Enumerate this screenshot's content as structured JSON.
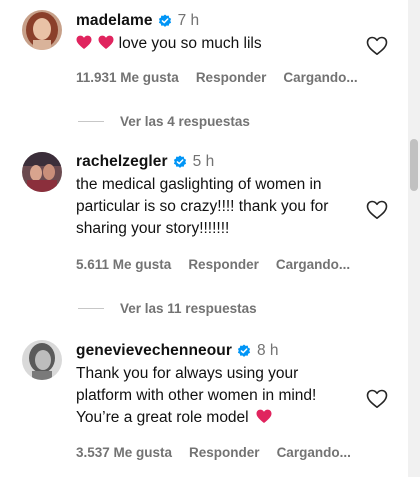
{
  "comments": [
    {
      "username": "madelame",
      "time": "7 h",
      "text": "love you so much lils",
      "likes": "11.931 Me gusta",
      "reply": "Responder",
      "loading": "Cargando...",
      "view_replies": "Ver las 4 respuestas"
    },
    {
      "username": "rachelzegler",
      "time": "5 h",
      "text": "the medical gaslighting of women in particular is so crazy!!!! thank you for sharing your story!!!!!!!",
      "likes": "5.611 Me gusta",
      "reply": "Responder",
      "loading": "Cargando...",
      "view_replies": "Ver las 11 respuestas"
    },
    {
      "username": "genevievechenneour",
      "time": "8 h",
      "text": "Thank you for always using your platform with other women in mind! You’re a great role model",
      "likes": "3.537 Me gusta",
      "reply": "Responder",
      "loading": "Cargando..."
    }
  ],
  "icons": {
    "verified": "verified-badge-icon",
    "like": "heart-outline-icon",
    "emoji": "red-heart-emoji"
  },
  "colors": {
    "verified": "#0095f6",
    "heart_emoji": "#e0245e",
    "secondary_text": "#737373"
  }
}
